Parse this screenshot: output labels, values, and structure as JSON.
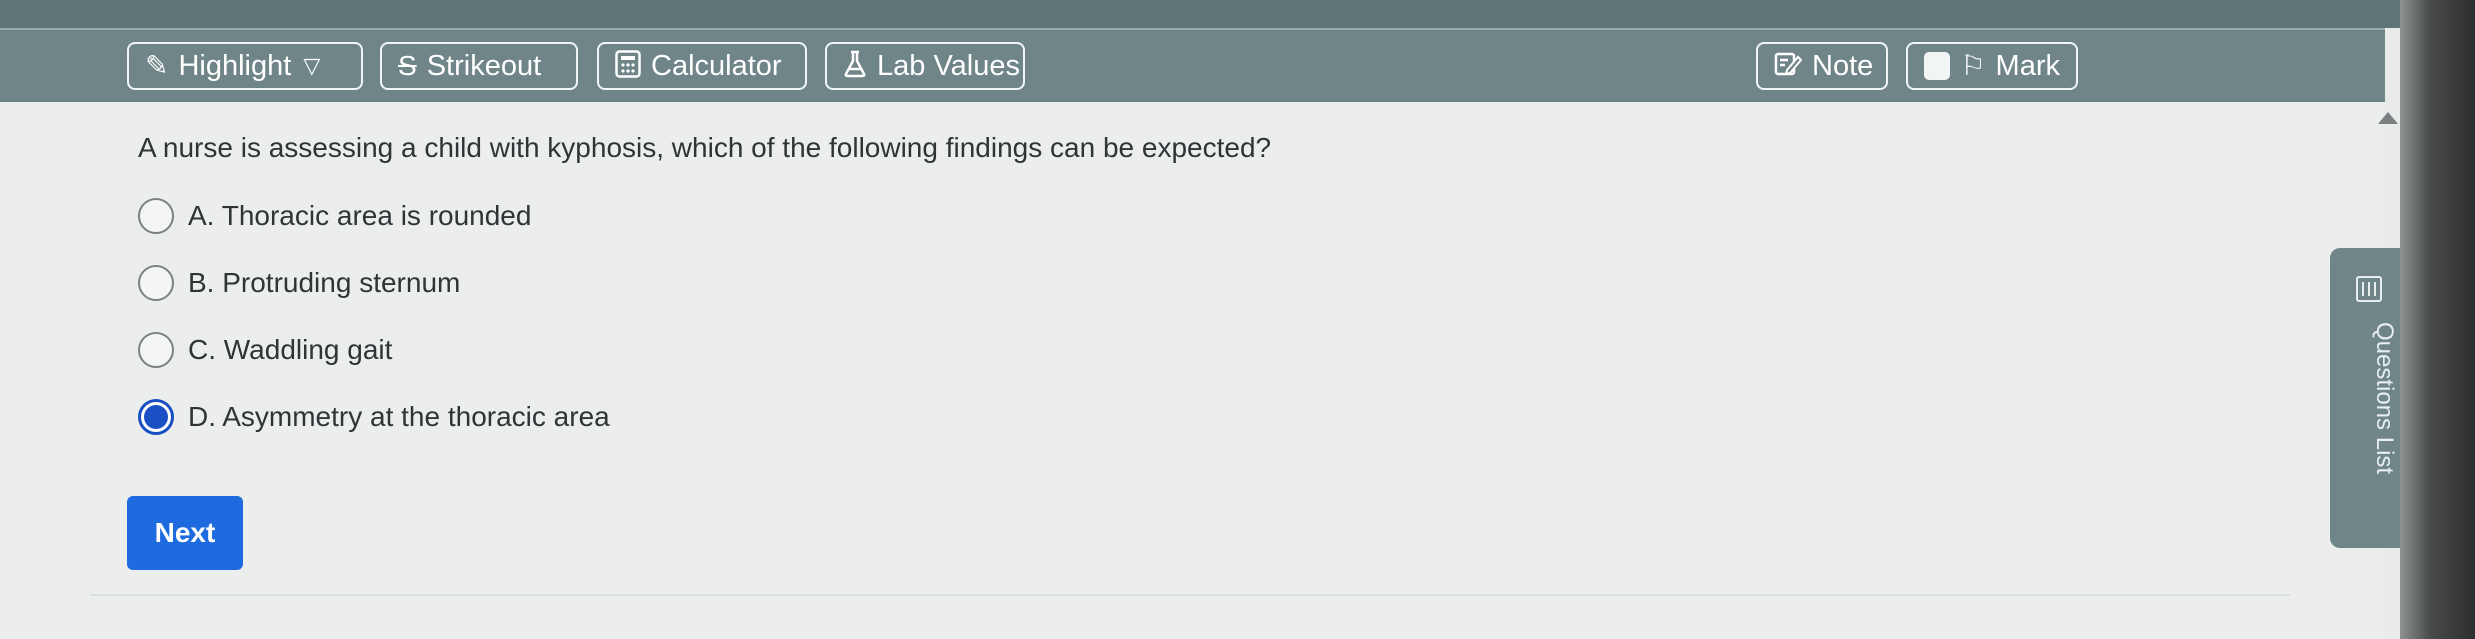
{
  "toolbar": {
    "highlight_label": "Highlight",
    "strikeout_label": "Strikeout",
    "calculator_label": "Calculator",
    "lab_values_label": "Lab Values",
    "note_label": "Note",
    "mark_label": "Mark"
  },
  "question": {
    "text": "A nurse is assessing a child with kyphosis, which of the following findings can be expected?",
    "options": [
      {
        "label": "A. Thoracic area is rounded",
        "selected": false
      },
      {
        "label": "B. Protruding sternum",
        "selected": false
      },
      {
        "label": "C. Waddling gait",
        "selected": false
      },
      {
        "label": "D. Asymmetry at the thoracic area",
        "selected": true
      }
    ]
  },
  "next_label": "Next",
  "side_panel": {
    "questions_list_label": "Questions List"
  },
  "colors": {
    "toolbar_bg": "#6f8588",
    "accent_blue": "#1e6be0",
    "selected_radio": "#1a4fc4",
    "content_bg": "#eceeed"
  },
  "icons": {
    "highlight": "highlighter-icon",
    "strikeout": "strikethrough-icon",
    "calculator": "calculator-icon",
    "lab_values": "flask-icon",
    "note": "note-edit-icon",
    "mark": "flag-icon",
    "questions_list": "list-icon"
  }
}
